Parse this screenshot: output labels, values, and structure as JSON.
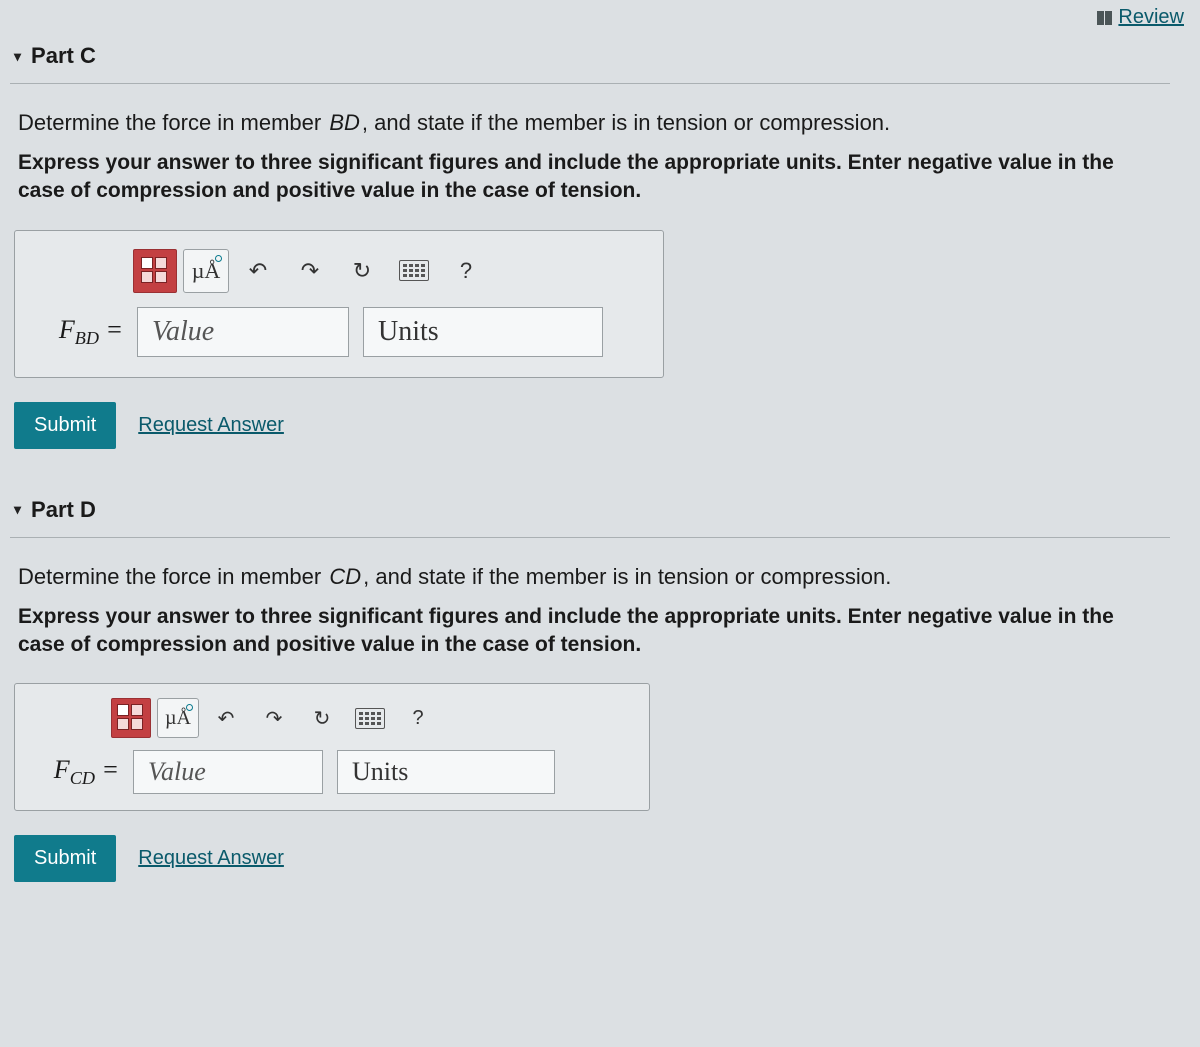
{
  "header": {
    "review_label": "Review"
  },
  "parts": {
    "c": {
      "title": "Part C",
      "prompt_pre": "Determine the force in member ",
      "member": "BD",
      "prompt_post": ", and state if the member is in tension or compression.",
      "instructions": "Express your answer to three significant figures and include the appropriate units. Enter negative value in the case of compression and positive value in the case of tension.",
      "var_html": "F<sub>BD</sub> =",
      "value_placeholder": "Value",
      "units_placeholder": "Units",
      "submit_label": "Submit",
      "request_label": "Request Answer"
    },
    "d": {
      "title": "Part D",
      "prompt_pre": "Determine the force in member ",
      "member": "CD",
      "prompt_post": ", and state if the member is in tension or compression.",
      "instructions": "Express your answer to three significant figures and include the appropriate units. Enter negative value in the case of compression and positive value in the case of tension.",
      "var_html": "F<sub>CD</sub> =",
      "value_placeholder": "Value",
      "units_placeholder": "Units",
      "submit_label": "Submit",
      "request_label": "Request Answer"
    }
  },
  "toolbar": {
    "mu_label": "µÅ",
    "help_label": "?"
  }
}
